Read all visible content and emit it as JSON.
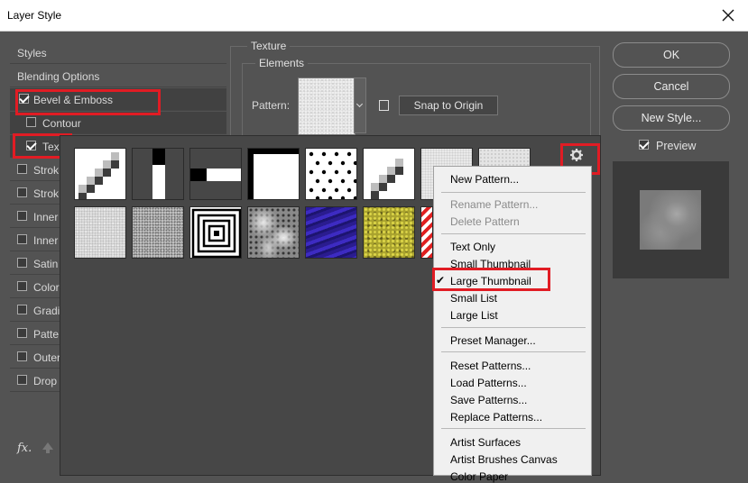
{
  "window": {
    "title": "Layer Style"
  },
  "styles_panel": {
    "items": [
      {
        "label": "Styles",
        "checkbox": false,
        "checked": false,
        "selected": false
      },
      {
        "label": "Blending Options",
        "checkbox": false,
        "checked": false,
        "selected": false
      },
      {
        "label": "Bevel & Emboss",
        "checkbox": true,
        "checked": true,
        "selected": true
      },
      {
        "label": "Contour",
        "checkbox": true,
        "checked": false,
        "selected": true
      },
      {
        "label": "Tex",
        "checkbox": true,
        "checked": true,
        "selected": true
      },
      {
        "label": "Strok",
        "checkbox": true,
        "checked": false,
        "selected": false
      },
      {
        "label": "Strok",
        "checkbox": true,
        "checked": false,
        "selected": false
      },
      {
        "label": "Inner",
        "checkbox": true,
        "checked": false,
        "selected": false
      },
      {
        "label": "Inner",
        "checkbox": true,
        "checked": false,
        "selected": false
      },
      {
        "label": "Satin",
        "checkbox": true,
        "checked": false,
        "selected": false
      },
      {
        "label": "Color",
        "checkbox": true,
        "checked": false,
        "selected": false
      },
      {
        "label": "Gradi",
        "checkbox": true,
        "checked": false,
        "selected": false
      },
      {
        "label": "Patte",
        "checkbox": true,
        "checked": false,
        "selected": false
      },
      {
        "label": "Outer",
        "checkbox": true,
        "checked": false,
        "selected": false
      },
      {
        "label": "Drop",
        "checkbox": true,
        "checked": false,
        "selected": false
      }
    ],
    "fx_label": "fx",
    "fx_dot": "."
  },
  "texture": {
    "group_title": "Texture",
    "elements_title": "Elements",
    "pattern_label": "Pattern:",
    "snap_button": "Snap to Origin"
  },
  "buttons": {
    "ok": "OK",
    "cancel": "Cancel",
    "new_style": "New Style...",
    "preview_label": "Preview",
    "preview_checked": true
  },
  "patterns": {
    "names": [
      "diagonal-squares",
      "vertical-bar",
      "horizontal-bar",
      "corner-square",
      "dots",
      "diagonal-squares-2",
      "gray-noise",
      "gray-noise-2",
      "fine-noise",
      "dense-noise",
      "concentric-squares",
      "marble",
      "blue-waves",
      "yellow-rock",
      "red-stripes"
    ]
  },
  "context_menu": {
    "items": [
      {
        "label": "New Pattern...",
        "disabled": false,
        "checked": false
      },
      {
        "label": "Rename Pattern...",
        "disabled": true,
        "checked": false
      },
      {
        "label": "Delete Pattern",
        "disabled": true,
        "checked": false
      },
      {
        "label": "Text Only",
        "disabled": false,
        "checked": false
      },
      {
        "label": "Small Thumbnail",
        "disabled": false,
        "checked": false
      },
      {
        "label": "Large Thumbnail",
        "disabled": false,
        "checked": true
      },
      {
        "label": "Small List",
        "disabled": false,
        "checked": false
      },
      {
        "label": "Large List",
        "disabled": false,
        "checked": false
      },
      {
        "label": "Preset Manager...",
        "disabled": false,
        "checked": false
      },
      {
        "label": "Reset Patterns...",
        "disabled": false,
        "checked": false
      },
      {
        "label": "Load Patterns...",
        "disabled": false,
        "checked": false
      },
      {
        "label": "Save Patterns...",
        "disabled": false,
        "checked": false
      },
      {
        "label": "Replace Patterns...",
        "disabled": false,
        "checked": false
      },
      {
        "label": "Artist Surfaces",
        "disabled": false,
        "checked": false
      },
      {
        "label": "Artist Brushes Canvas",
        "disabled": false,
        "checked": false
      },
      {
        "label": "Color Paper",
        "disabled": false,
        "checked": false
      }
    ],
    "check_glyph": "✔"
  },
  "icons": {
    "close": "close-icon",
    "gear": "gear-icon",
    "new_preset": "new-preset-icon",
    "dropdown": "chevron-down-icon",
    "up_arrow": "move-up-arrow-icon"
  },
  "colors": {
    "highlight_red": "#e11c24",
    "dialog_bg": "#535353"
  }
}
